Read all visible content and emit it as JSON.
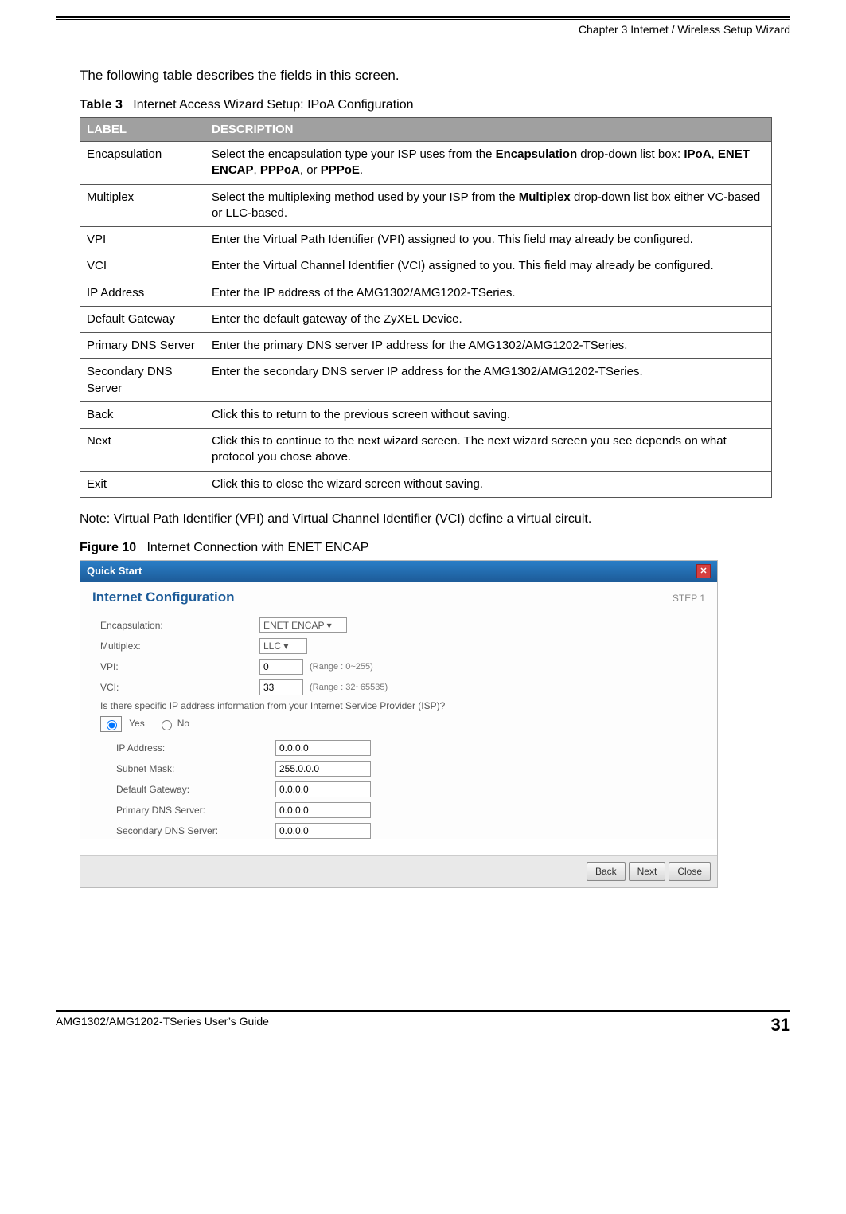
{
  "header": {
    "chapter": "Chapter 3 Internet / Wireless Setup Wizard"
  },
  "intro": "The following table describes the fields in this screen.",
  "table_caption_label": "Table 3",
  "table_caption_text": "Internet Access Wizard Setup: IPoA Configuration",
  "table": {
    "head_label": "LABEL",
    "head_desc": "DESCRIPTION",
    "rows": [
      {
        "label": "Encapsulation",
        "desc_pre": "Select the encapsulation type your ISP uses from the ",
        "desc_bold1": "Encapsulation",
        "desc_mid1": " drop-down list box: ",
        "b1": "IPoA",
        "s1": ", ",
        "b2": "ENET ENCAP",
        "s2": ", ",
        "b3": "PPPoA",
        "s3": ", or ",
        "b4": "PPPoE",
        "s4": "."
      },
      {
        "label": "Multiplex",
        "desc_pre": "Select the multiplexing method used by your ISP from the ",
        "desc_bold1": "Multiplex",
        "desc_post": " drop-down list box either VC-based or LLC-based."
      },
      {
        "label": "VPI",
        "desc": "Enter the Virtual Path Identifier (VPI) assigned to you. This field may already be configured."
      },
      {
        "label": "VCI",
        "desc": "Enter the Virtual Channel Identifier (VCI) assigned to you. This field may already be configured."
      },
      {
        "label": "IP Address",
        "desc": "Enter the IP address of the AMG1302/AMG1202-TSeries."
      },
      {
        "label": "Default Gateway",
        "desc": "Enter the default gateway of the ZyXEL Device."
      },
      {
        "label": "Primary DNS Server",
        "desc": "Enter the primary DNS server IP address for the AMG1302/AMG1202-TSeries."
      },
      {
        "label": "Secondary DNS Server",
        "desc": "Enter the secondary DNS server IP address for the AMG1302/AMG1202-TSeries."
      },
      {
        "label": "Back",
        "desc": "Click this to return to the previous screen without saving."
      },
      {
        "label": "Next",
        "desc": "Click this to continue to the next wizard screen. The next wizard screen you see depends on what protocol you chose above."
      },
      {
        "label": "Exit",
        "desc": "Click this to close the wizard screen without saving."
      }
    ]
  },
  "note": "Note: Virtual Path Identifier (VPI) and Virtual Channel Identifier (VCI) define a virtual circuit.",
  "fig_caption_label": "Figure 10",
  "fig_caption_text": "Internet Connection with ENET ENCAP",
  "figure": {
    "header_title": "Quick Start",
    "section_title": "Internet Configuration",
    "step": "STEP 1",
    "labels": {
      "encap": "Encapsulation:",
      "multiplex": "Multiplex:",
      "vpi": "VPI:",
      "vci": "VCI:",
      "question": "Is there specific IP address information from your Internet Service Provider (ISP)?",
      "yes": "Yes",
      "no": "No",
      "ip": "IP Address:",
      "subnet": "Subnet Mask:",
      "gateway": "Default Gateway:",
      "pdns": "Primary DNS Server:",
      "sdns": "Secondary DNS Server:"
    },
    "values": {
      "encap": "ENET ENCAP",
      "multiplex": "LLC",
      "vpi": "0",
      "vci": "33",
      "vpi_hint": "(Range : 0~255)",
      "vci_hint": "(Range : 32~65535)",
      "ip": "0.0.0.0",
      "subnet": "255.0.0.0",
      "gateway": "0.0.0.0",
      "pdns": "0.0.0.0",
      "sdns": "0.0.0.0"
    },
    "buttons": {
      "back": "Back",
      "next": "Next",
      "close": "Close"
    }
  },
  "footer": {
    "guide": "AMG1302/AMG1202-TSeries User’s Guide",
    "page": "31"
  }
}
